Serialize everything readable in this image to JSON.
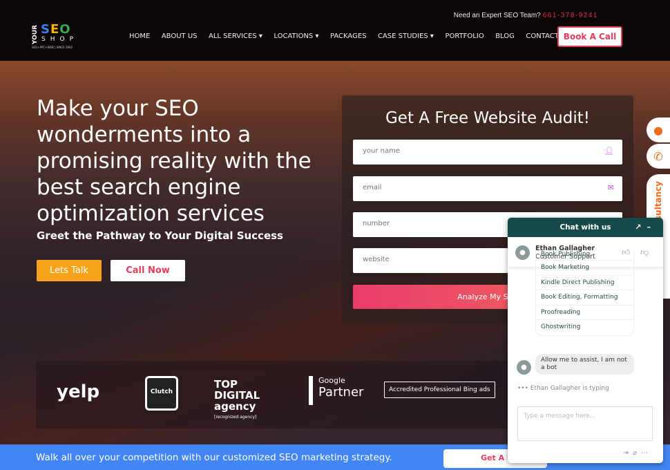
{
  "header": {
    "top_text": "Need an Expert SEO Team?",
    "phone": "661-378-9241",
    "logo": {
      "your": "YOUR",
      "seo": "SEO",
      "shop": "SHOP",
      "tagline": "SEO+PPC+WEB | SINCE 2002"
    },
    "nav": [
      {
        "label": "HOME"
      },
      {
        "label": "ABOUT US"
      },
      {
        "label": "ALL SERVICES ▾"
      },
      {
        "label": "LOCATIONS ▾"
      },
      {
        "label": "PACKAGES"
      },
      {
        "label": "CASE STUDIES ▾"
      },
      {
        "label": "PORTFOLIO"
      },
      {
        "label": "BLOG"
      },
      {
        "label": "CONTACT US"
      }
    ],
    "cta": "Book A Call"
  },
  "hero": {
    "headline": "Make your SEO wonderments into a promising reality with the best search engine optimization services",
    "subheadline": "Greet the Pathway to Your Digital Success",
    "lets_talk": "Lets Talk",
    "call_now": "Call Now"
  },
  "form": {
    "title": "Get A Free Website Audit!",
    "name_placeholder": "your name",
    "email_placeholder": "email",
    "number_placeholder": "number",
    "website_placeholder": "website",
    "submit": "Analyze My Site"
  },
  "badges": {
    "yelp": "yelp",
    "clutch": "Clutch",
    "top": "TOP DIGITAL agency",
    "top_sub": "[recognized agency]",
    "google": "Google",
    "partner": "Partner",
    "bing": "Accredited Professional  Bing ads"
  },
  "side": {
    "consultancy": "Free SEO Consultancy"
  },
  "banner": {
    "text": "Walk all over your competition with our customized SEO marketing strategy.",
    "button": "Get A Free Quote"
  },
  "chat": {
    "title": "Chat with us",
    "agent_name": "Ethan Gallagher",
    "agent_role": "Customer Support",
    "options": [
      "Book Publishing",
      "Book Marketing",
      "Kindle Direct Publishing",
      "Book Editing, Formatting",
      "Proofreading",
      "Ghostwriting"
    ],
    "message": "Allow me to assist, I am not a bot",
    "typing": "Ethan Gallagher is typing",
    "input_placeholder": "Type a message here..."
  },
  "colors": {
    "accent": "#e63d5a",
    "banner": "#4285f4",
    "chat_header": "#164a4a",
    "orange": "#f7a21b"
  }
}
